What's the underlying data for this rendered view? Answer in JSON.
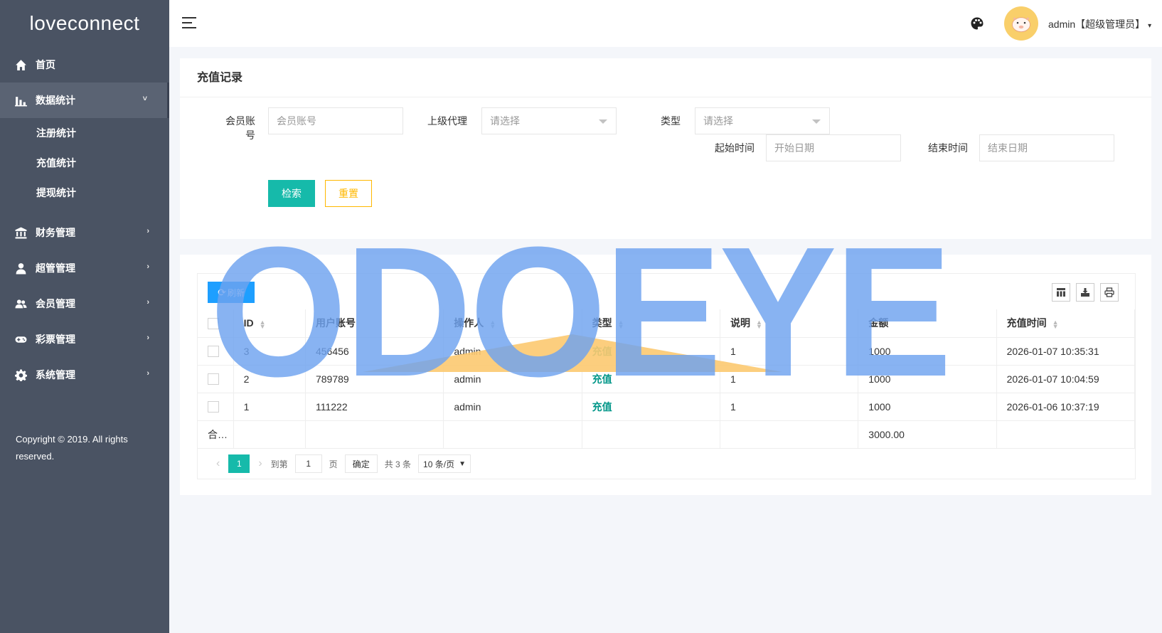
{
  "app": {
    "logo": "loveconnect"
  },
  "sidebar": {
    "items": [
      {
        "label": "首页",
        "icon": "home-icon"
      },
      {
        "label": "数据统计",
        "icon": "bar-chart-icon",
        "arrow": "˅"
      },
      {
        "label": "财务管理",
        "icon": "bank-icon",
        "arrow": "›"
      },
      {
        "label": "超管管理",
        "icon": "user-icon",
        "arrow": "›"
      },
      {
        "label": "会员管理",
        "icon": "users-icon",
        "arrow": "›"
      },
      {
        "label": "彩票管理",
        "icon": "gamepad-icon",
        "arrow": "›"
      },
      {
        "label": "系统管理",
        "icon": "gear-icon",
        "arrow": "›"
      }
    ],
    "sub_items": [
      "注册统计",
      "充值统计",
      "提现统计"
    ],
    "copyright": "Copyright © 2019. All rights reserved."
  },
  "header": {
    "user_label": "admin【超级管理员】",
    "caret": "▾"
  },
  "search": {
    "title": "充值记录",
    "member_label": "会员账号",
    "member_placeholder": "会员账号",
    "agent_label": "上级代理",
    "agent_value": "请选择",
    "type_label": "类型",
    "type_value": "请选择",
    "start_label": "起始时间",
    "start_placeholder": "开始日期",
    "end_label": "结束时间",
    "end_placeholder": "结束日期",
    "search_btn": "检索",
    "reset_btn": "重置"
  },
  "table": {
    "refresh_btn": "刷新",
    "columns": [
      "ID",
      "用户账号",
      "操作人",
      "类型",
      "说明",
      "金额",
      "充值时间"
    ],
    "rows": [
      {
        "id": "3",
        "account": "456456",
        "operator": "admin",
        "type": "充值",
        "note": "1",
        "amount": "1000",
        "time": "2026-01-07 10:35:31"
      },
      {
        "id": "2",
        "account": "789789",
        "operator": "admin",
        "type": "充值",
        "note": "1",
        "amount": "1000",
        "time": "2026-01-07 10:04:59"
      },
      {
        "id": "1",
        "account": "111222",
        "operator": "admin",
        "type": "充值",
        "note": "1",
        "amount": "1000",
        "time": "2026-01-06 10:37:19"
      }
    ],
    "total_label": "合…",
    "total_amount": "3000.00"
  },
  "pager": {
    "prev": "‹",
    "current": "1",
    "next": "›",
    "goto_label": "到第",
    "goto_value": "1",
    "page_unit": "页",
    "confirm": "确定",
    "total": "共 3 条",
    "page_size": "10 条/页"
  },
  "watermark": {
    "text": "ODOEYE",
    "color": "#6ea3f0",
    "accent": "#fcc970"
  }
}
